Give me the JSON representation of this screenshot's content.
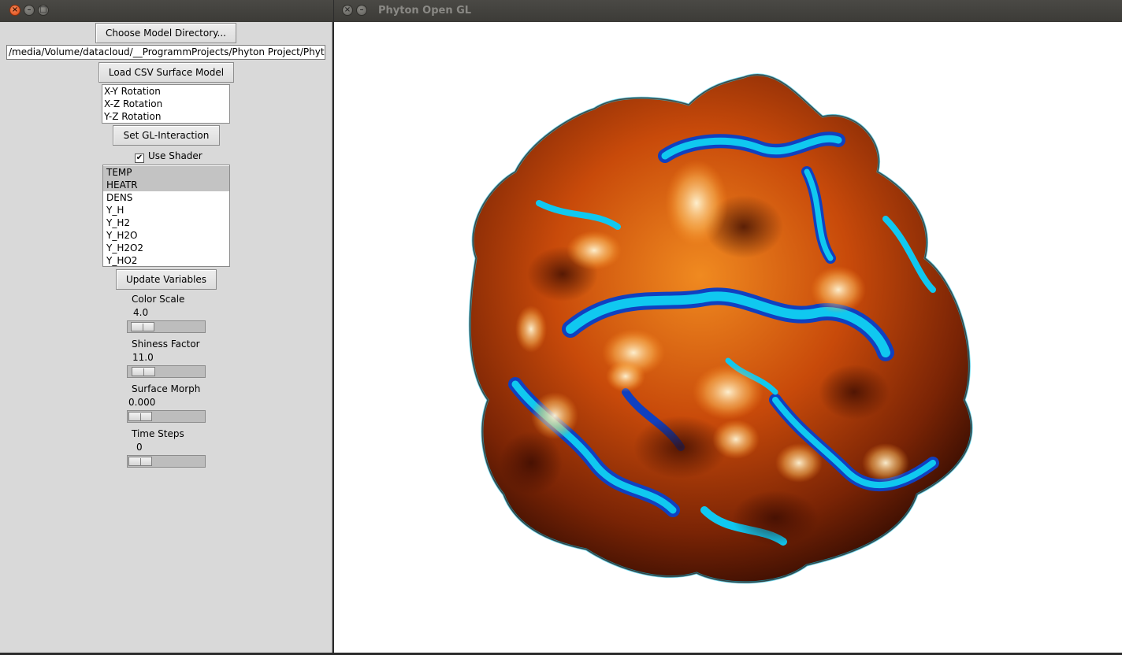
{
  "left_window": {
    "buttons": {
      "close": "×",
      "minimize": "–",
      "maximize": "□"
    }
  },
  "right_window": {
    "title": "Phyton Open GL",
    "buttons": {
      "close": "×",
      "minimize": "–"
    }
  },
  "panel": {
    "choose_dir_label": "Choose Model Directory...",
    "path_value": "/media/Volume/datacloud/__ProgrammProjects/Phyton Project/Phyt",
    "load_csv_label": "Load CSV Surface Model",
    "interaction_options": [
      "X-Y Rotation",
      "X-Z Rotation",
      "Y-Z Rotation"
    ],
    "set_gl_label": "Set GL-Interaction",
    "use_shader_label": "Use Shader",
    "use_shader_checked": true,
    "variables": [
      "TEMP",
      "HEATR",
      "DENS",
      "Y_H",
      "Y_H2",
      "Y_H2O",
      "Y_H2O2",
      "Y_HO2"
    ],
    "selected_variables": [
      "TEMP",
      "HEATR"
    ],
    "update_label": "Update Variables",
    "sliders": [
      {
        "label": "Color Scale",
        "value": "4.0",
        "level": 0.05
      },
      {
        "label": "Shiness Factor",
        "value": "11.0",
        "level": 0.06
      },
      {
        "label": "Surface Morph",
        "value": "0.000",
        "level": 0.0
      },
      {
        "label": "Time Steps",
        "value": "0",
        "level": 0.0
      }
    ]
  },
  "colors": {
    "surface_dark": "#5a1a05",
    "surface_orange": "#e06a10",
    "surface_highlight": "#ffe9a0",
    "surface_cyan": "#10c8f0",
    "surface_blue": "#1040c0"
  }
}
